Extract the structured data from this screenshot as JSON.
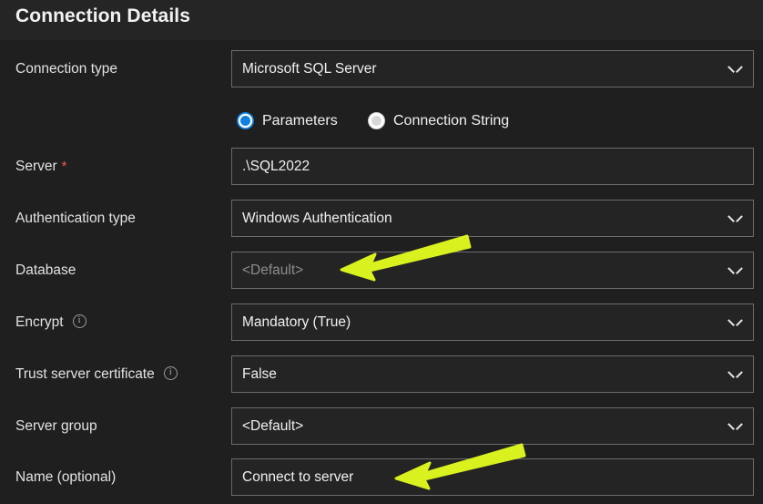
{
  "header": {
    "title": "Connection Details"
  },
  "form": {
    "connection_type": {
      "label": "Connection type",
      "value": "Microsoft SQL Server",
      "control": "dropdown",
      "chevron_icon": "chevron-down-icon"
    },
    "mode_radio": {
      "options": [
        {
          "label": "Parameters",
          "selected": true
        },
        {
          "label": "Connection String",
          "selected": false
        }
      ],
      "selected_color": "#0f7fe0"
    },
    "server": {
      "label": "Server",
      "required_marker": "*",
      "required_color": "#f05a5a",
      "value": ".\\SQL2022",
      "control": "text"
    },
    "authentication_type": {
      "label": "Authentication type",
      "value": "Windows Authentication",
      "control": "dropdown",
      "chevron_icon": "chevron-down-icon"
    },
    "database": {
      "label": "Database",
      "value": "<Default>",
      "is_placeholder": true,
      "control": "dropdown",
      "chevron_icon": "chevron-down-icon"
    },
    "encrypt": {
      "label": "Encrypt",
      "info_icon": "info-icon",
      "value": "Mandatory (True)",
      "control": "dropdown",
      "chevron_icon": "chevron-down-icon"
    },
    "trust_server_certificate": {
      "label": "Trust server certificate",
      "info_icon": "info-icon",
      "value": "False",
      "control": "dropdown",
      "chevron_icon": "chevron-down-icon"
    },
    "server_group": {
      "label": "Server group",
      "value": "<Default>",
      "is_placeholder": false,
      "control": "dropdown",
      "chevron_icon": "chevron-down-icon"
    },
    "name_optional": {
      "label": "Name (optional)",
      "value": "Connect to server",
      "control": "text"
    }
  },
  "annotations": {
    "arrow_color": "#d9f11f",
    "arrows": [
      {
        "name": "arrow-pointing-to-database-field",
        "target": "database"
      },
      {
        "name": "arrow-pointing-to-name-field",
        "target": "name_optional"
      }
    ]
  }
}
